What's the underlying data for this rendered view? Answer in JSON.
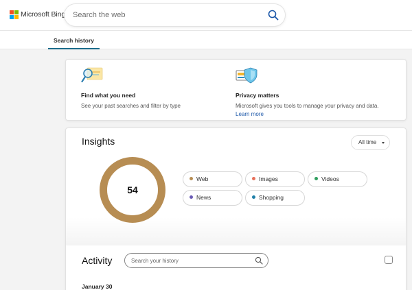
{
  "header": {
    "logo_text": "Microsoft Bing",
    "logo_colors": [
      "#f25022",
      "#7fba00",
      "#00a4ef",
      "#ffb900"
    ],
    "search_placeholder": "Search the web",
    "search_icon": "search-icon"
  },
  "tabs": [
    {
      "label": "Search history",
      "active": true
    }
  ],
  "info_cards": [
    {
      "title": "Find what you need",
      "description": "See your past searches and filter by type",
      "icon": "magnifier-illustration"
    },
    {
      "title": "Privacy matters",
      "description": "Microsoft gives you tools to manage your privacy and data.",
      "link": "Learn more",
      "icon": "shield-illustration"
    }
  ],
  "insights": {
    "title": "Insights",
    "range_selected": "All time",
    "total": "54",
    "donut_color": "#b78d53",
    "categories": [
      {
        "label": "Web",
        "color": "#b78d53"
      },
      {
        "label": "Images",
        "color": "#e8705a"
      },
      {
        "label": "Videos",
        "color": "#2f9e5e"
      },
      {
        "label": "News",
        "color": "#6a5bb5"
      },
      {
        "label": "Shopping",
        "color": "#1f7fa8"
      }
    ]
  },
  "activity": {
    "title": "Activity",
    "search_placeholder": "Search your history",
    "date_heading": "January 30"
  },
  "colors": {
    "accent": "#1b6b8a",
    "link": "#1a56a8"
  }
}
